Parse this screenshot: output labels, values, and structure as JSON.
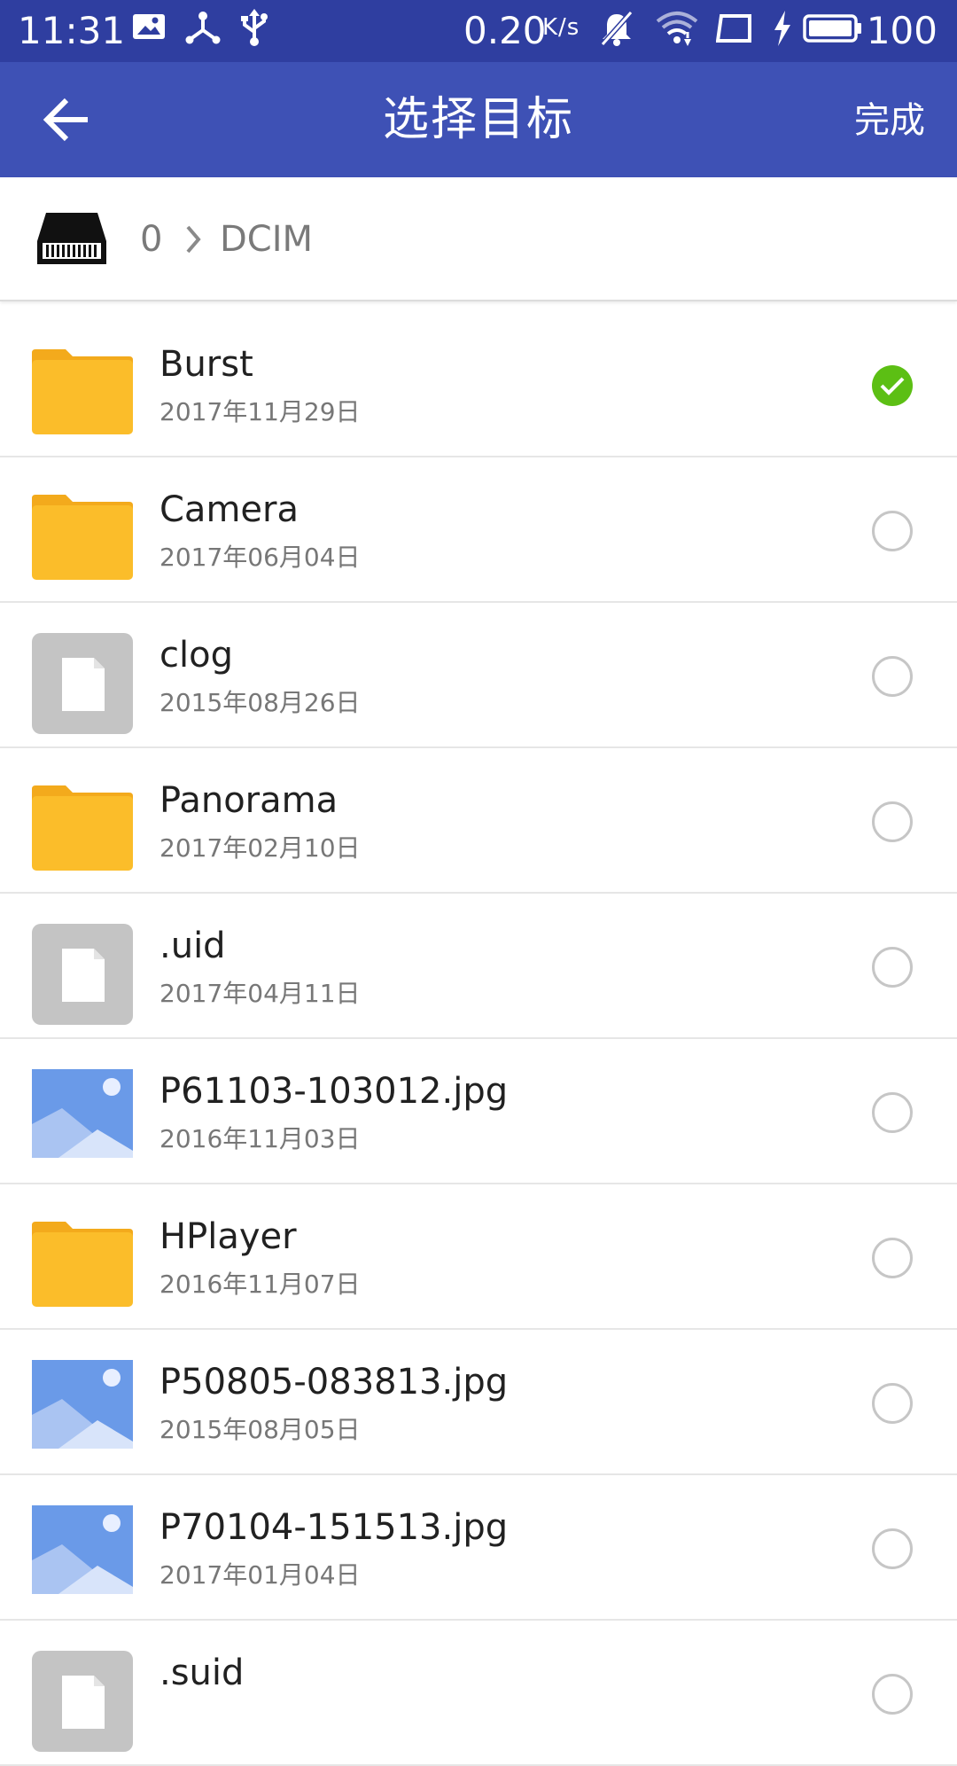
{
  "status_bar": {
    "time": "11:31",
    "net_speed": "0.20",
    "net_speed_unit": "K/s",
    "battery": "100",
    "icons": [
      "image-icon",
      "usb-tree-icon",
      "usb-icon",
      "bell-off-icon",
      "wifi-icon",
      "screen-icon",
      "charging-icon",
      "battery-icon"
    ]
  },
  "app_bar": {
    "title": "选择目标",
    "done_label": "完成",
    "back_icon": "arrow-left-icon"
  },
  "breadcrumb": {
    "root": "0",
    "current": "DCIM",
    "drive_icon": "storage-drive-icon"
  },
  "files": [
    {
      "name": "Burst",
      "date": "2017年11月29日",
      "type": "folder",
      "selected": true
    },
    {
      "name": "Camera",
      "date": "2017年06月04日",
      "type": "folder",
      "selected": false
    },
    {
      "name": "clog",
      "date": "2015年08月26日",
      "type": "file",
      "selected": false
    },
    {
      "name": "Panorama",
      "date": "2017年02月10日",
      "type": "folder",
      "selected": false
    },
    {
      "name": ".uid",
      "date": "2017年04月11日",
      "type": "file",
      "selected": false
    },
    {
      "name": "P61103-103012.jpg",
      "date": "2016年11月03日",
      "type": "image",
      "selected": false
    },
    {
      "name": "HPlayer",
      "date": "2016年11月07日",
      "type": "folder",
      "selected": false
    },
    {
      "name": "P50805-083813.jpg",
      "date": "2015年08月05日",
      "type": "image",
      "selected": false
    },
    {
      "name": "P70104-151513.jpg",
      "date": "2017年01月04日",
      "type": "image",
      "selected": false
    },
    {
      "name": ".suid",
      "date": "",
      "type": "file",
      "selected": false
    }
  ],
  "colors": {
    "status_bar": "#2f3ea0",
    "app_bar": "#3e51b5",
    "folder": "#fbbd2a",
    "file_bg": "#c4c4c4",
    "image_bg": "#6a9ae8",
    "check": "#5cbf14"
  }
}
